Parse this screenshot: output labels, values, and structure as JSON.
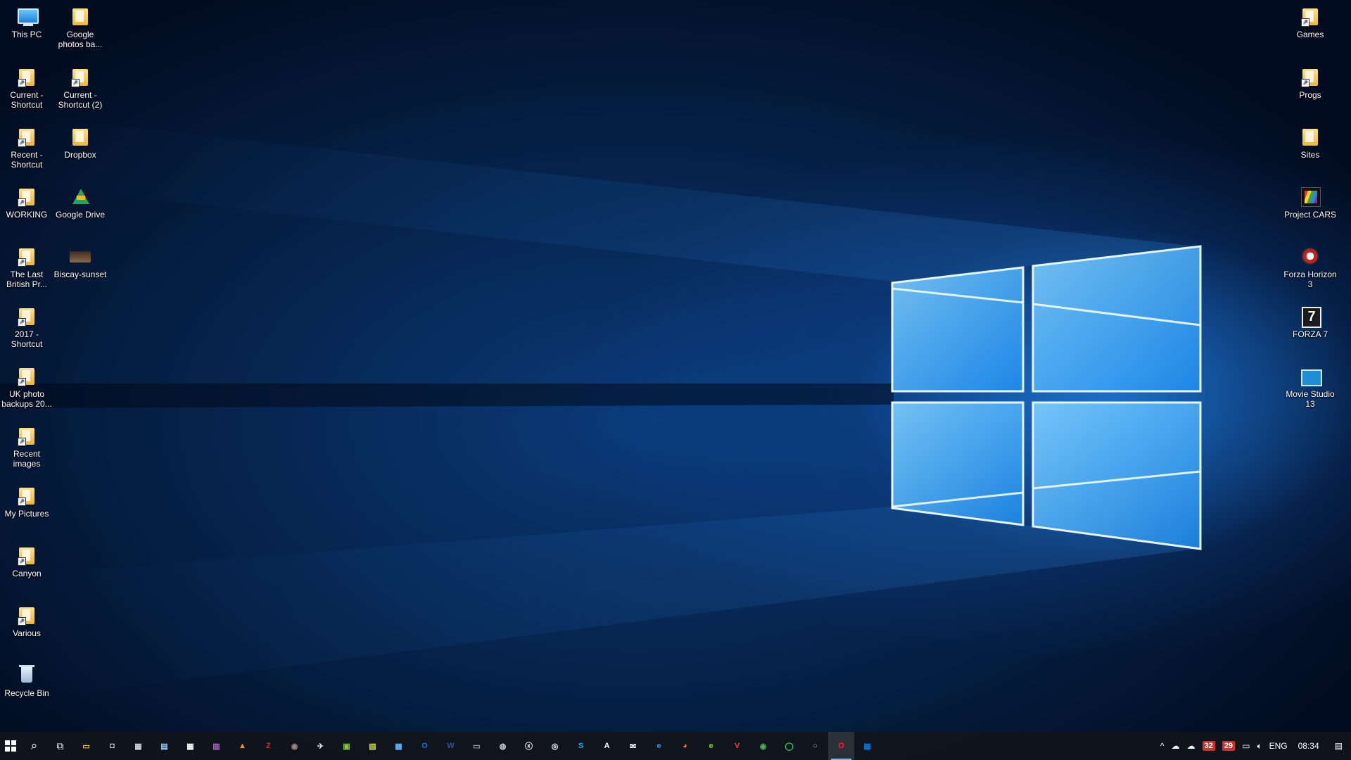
{
  "desktop": {
    "icons_left_col1": [
      {
        "label": "This PC",
        "icon": "computer-icon"
      },
      {
        "label": "Current - Shortcut",
        "icon": "folder-shortcut-icon"
      },
      {
        "label": "Recent - Shortcut",
        "icon": "folder-shortcut-icon"
      },
      {
        "label": "WORKING",
        "icon": "folder-shortcut-icon"
      },
      {
        "label": "The Last British Pr...",
        "icon": "folder-shortcut-icon"
      },
      {
        "label": "2017 - Shortcut",
        "icon": "folder-shortcut-icon"
      },
      {
        "label": "UK photo backups 20...",
        "icon": "folder-shortcut-icon"
      },
      {
        "label": "Recent images",
        "icon": "folder-shortcut-icon"
      },
      {
        "label": "My Pictures",
        "icon": "folder-shortcut-icon"
      },
      {
        "label": "Canyon",
        "icon": "folder-shortcut-icon"
      },
      {
        "label": "Various",
        "icon": "folder-shortcut-icon"
      },
      {
        "label": "Recycle Bin",
        "icon": "recycle-bin-icon"
      }
    ],
    "icons_left_col2": [
      {
        "label": "Google photos ba...",
        "icon": "folder-icon"
      },
      {
        "label": "Current - Shortcut (2)",
        "icon": "folder-shortcut-icon"
      },
      {
        "label": "Dropbox",
        "icon": "folder-icon"
      },
      {
        "label": "Google Drive",
        "icon": "google-drive-icon"
      },
      {
        "label": "Biscay-sunset",
        "icon": "image-file-icon"
      }
    ],
    "icons_right": [
      {
        "label": "Games",
        "icon": "folder-shortcut-icon"
      },
      {
        "label": "Progs",
        "icon": "folder-shortcut-icon"
      },
      {
        "label": "Sites",
        "icon": "folder-icon"
      },
      {
        "label": "Project CARS",
        "icon": "project-cars-icon"
      },
      {
        "label": "Forza Horizon 3",
        "icon": "forza-horizon-icon"
      },
      {
        "label": "FORZA 7",
        "icon": "forza-7-icon",
        "glyph": "7"
      },
      {
        "label": "Movie Studio 13",
        "icon": "movie-studio-icon"
      }
    ]
  },
  "taskbar": {
    "pinned": [
      {
        "name": "file-explorer",
        "glyph": "▭",
        "color": "#f2c14e"
      },
      {
        "name": "store",
        "glyph": "◘",
        "color": "#e0e0e0"
      },
      {
        "name": "calculator",
        "glyph": "▦",
        "color": "#cfd8dc"
      },
      {
        "name": "notepad",
        "glyph": "▤",
        "color": "#90caf9"
      },
      {
        "name": "calendar",
        "glyph": "▦",
        "color": "#ffffff"
      },
      {
        "name": "winrar",
        "glyph": "▥",
        "color": "#b36bc8"
      },
      {
        "name": "vlc",
        "glyph": "▲",
        "color": "#ff9800"
      },
      {
        "name": "filezilla",
        "glyph": "Z",
        "color": "#d32f2f"
      },
      {
        "name": "gimp",
        "glyph": "◉",
        "color": "#a1887f"
      },
      {
        "name": "flight-app",
        "glyph": "✈",
        "color": "#e0e0e0"
      },
      {
        "name": "photos",
        "glyph": "▣",
        "color": "#8bc34a"
      },
      {
        "name": "gallery",
        "glyph": "▧",
        "color": "#cddc39"
      },
      {
        "name": "remote-desktop",
        "glyph": "▩",
        "color": "#64b5f6"
      },
      {
        "name": "outlook",
        "glyph": "O",
        "color": "#1e6fc6"
      },
      {
        "name": "word",
        "glyph": "W",
        "color": "#2b579a"
      },
      {
        "name": "monitor-app",
        "glyph": "▭",
        "color": "#90a4ae"
      },
      {
        "name": "steam",
        "glyph": "◍",
        "color": "#c5d1db"
      },
      {
        "name": "xbox",
        "glyph": "ⓧ",
        "color": "#ffffff"
      },
      {
        "name": "spotify",
        "glyph": "◎",
        "color": "#ffffff"
      },
      {
        "name": "skype",
        "glyph": "S",
        "color": "#00aff0"
      },
      {
        "name": "adobe",
        "glyph": "A",
        "color": "#ffffff"
      },
      {
        "name": "mail",
        "glyph": "✉",
        "color": "#ffffff"
      },
      {
        "name": "edge",
        "glyph": "e",
        "color": "#3a96dd"
      },
      {
        "name": "firefox",
        "glyph": "◕",
        "color": "#ff7139"
      },
      {
        "name": "internet-explorer",
        "glyph": "e",
        "color": "#7ed321"
      },
      {
        "name": "vivaldi",
        "glyph": "V",
        "color": "#ef3939"
      },
      {
        "name": "chrome",
        "glyph": "◉",
        "color": "#4caf50"
      },
      {
        "name": "whatsapp",
        "glyph": "◯",
        "color": "#25d366"
      },
      {
        "name": "circle-app",
        "glyph": "○",
        "color": "#8bc34a"
      },
      {
        "name": "opera",
        "glyph": "O",
        "color": "#ff1b2d",
        "active": true
      },
      {
        "name": "store-blue",
        "glyph": "▦",
        "color": "#0078d7"
      }
    ],
    "tray": {
      "chevron": "^",
      "badge1": "32",
      "badge2": "29",
      "language": "ENG",
      "time": "08:34"
    }
  }
}
